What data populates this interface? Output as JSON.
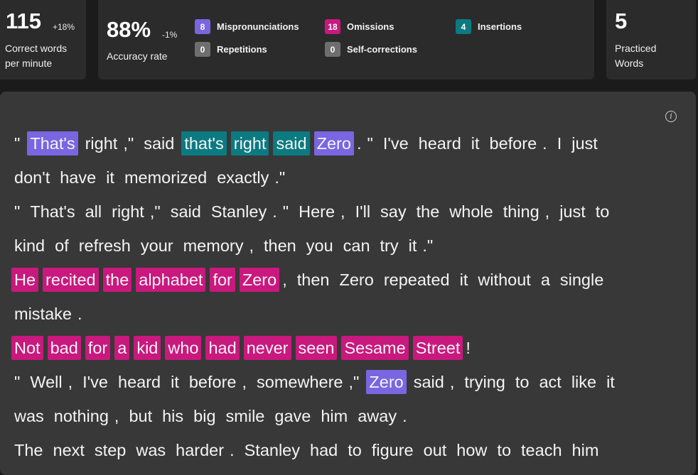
{
  "stats": {
    "wpm": {
      "value": "115",
      "delta": "+18%",
      "label_line1": "Correct words",
      "label_line2": "per minute"
    },
    "accuracy": {
      "value": "88%",
      "delta": "-1%",
      "label": "Accuracy rate"
    },
    "practiced": {
      "value": "5",
      "label_line1": "Practiced",
      "label_line2": "Words"
    }
  },
  "legend": [
    {
      "count": "8",
      "label": "Mispronunciations",
      "color": "#7966e0"
    },
    {
      "count": "18",
      "label": "Omissions",
      "color": "#c9187e"
    },
    {
      "count": "4",
      "label": "Insertions",
      "color": "#0c7a81"
    },
    {
      "count": "0",
      "label": "Repetitions",
      "color": "#6e6e6e"
    },
    {
      "count": "0",
      "label": "Self-corrections",
      "color": "#6e6e6e"
    }
  ],
  "passage": {
    "info_icon_glyph": "i",
    "lines": [
      [
        [
          "\"",
          ""
        ],
        [
          "That's",
          "purple"
        ],
        [
          "right",
          ""
        ],
        [
          ",\"",
          ""
        ],
        [
          "said",
          ""
        ],
        [
          "that's",
          "teal"
        ],
        [
          "right",
          "teal"
        ],
        [
          "said",
          "teal"
        ],
        [
          "Zero",
          "purple"
        ],
        [
          ".",
          ""
        ],
        [
          "\"",
          ""
        ],
        [
          "I've",
          ""
        ],
        [
          "heard",
          ""
        ],
        [
          "it",
          ""
        ],
        [
          "before",
          ""
        ],
        [
          ".",
          ""
        ],
        [
          "I",
          ""
        ],
        [
          "just",
          ""
        ]
      ],
      [
        [
          "don't",
          ""
        ],
        [
          "have",
          ""
        ],
        [
          "it",
          ""
        ],
        [
          "memorized",
          ""
        ],
        [
          "exactly",
          ""
        ],
        [
          ".\"",
          ""
        ]
      ],
      [
        [
          "\"",
          ""
        ],
        [
          "That's",
          ""
        ],
        [
          "all",
          ""
        ],
        [
          "right",
          ""
        ],
        [
          ",\"",
          ""
        ],
        [
          "said",
          ""
        ],
        [
          "Stanley",
          ""
        ],
        [
          ".",
          ""
        ],
        [
          "\"",
          ""
        ],
        [
          "Here",
          ""
        ],
        [
          ",",
          ""
        ],
        [
          "I'll",
          ""
        ],
        [
          "say",
          ""
        ],
        [
          "the",
          ""
        ],
        [
          "whole",
          ""
        ],
        [
          "thing",
          ""
        ],
        [
          ",",
          ""
        ],
        [
          "just",
          ""
        ],
        [
          "to",
          ""
        ]
      ],
      [
        [
          "kind",
          ""
        ],
        [
          "of",
          ""
        ],
        [
          "refresh",
          ""
        ],
        [
          "your",
          ""
        ],
        [
          "memory",
          ""
        ],
        [
          ",",
          ""
        ],
        [
          "then",
          ""
        ],
        [
          "you",
          ""
        ],
        [
          "can",
          ""
        ],
        [
          "try",
          ""
        ],
        [
          "it",
          ""
        ],
        [
          ".\"",
          ""
        ]
      ],
      [
        [
          "He",
          "pink"
        ],
        [
          "recited",
          "pink"
        ],
        [
          "the",
          "pink"
        ],
        [
          "alphabet",
          "pink"
        ],
        [
          "for",
          "pink"
        ],
        [
          "Zero",
          "pink"
        ],
        [
          ",",
          ""
        ],
        [
          "then",
          ""
        ],
        [
          "Zero",
          ""
        ],
        [
          "repeated",
          ""
        ],
        [
          "it",
          ""
        ],
        [
          "without",
          ""
        ],
        [
          "a",
          ""
        ],
        [
          "single",
          ""
        ]
      ],
      [
        [
          "mistake",
          ""
        ],
        [
          ".",
          ""
        ]
      ],
      [
        [
          "Not",
          "pink"
        ],
        [
          "bad",
          "pink"
        ],
        [
          "for",
          "pink"
        ],
        [
          "a",
          "pink"
        ],
        [
          "kid",
          "pink"
        ],
        [
          "who",
          "pink"
        ],
        [
          "had",
          "pink"
        ],
        [
          "never",
          "pink"
        ],
        [
          "seen",
          "pink"
        ],
        [
          "Sesame",
          "pink"
        ],
        [
          "Street",
          "pink"
        ],
        [
          "!",
          ""
        ]
      ],
      [
        [
          "\"",
          ""
        ],
        [
          "Well",
          ""
        ],
        [
          ",",
          ""
        ],
        [
          "I've",
          ""
        ],
        [
          "heard",
          ""
        ],
        [
          "it",
          ""
        ],
        [
          "before",
          ""
        ],
        [
          ",",
          ""
        ],
        [
          "somewhere",
          ""
        ],
        [
          ",\"",
          ""
        ],
        [
          "Zero",
          "purple"
        ],
        [
          "said",
          ""
        ],
        [
          ",",
          ""
        ],
        [
          "trying",
          ""
        ],
        [
          "to",
          ""
        ],
        [
          "act",
          ""
        ],
        [
          "like",
          ""
        ],
        [
          "it",
          ""
        ]
      ],
      [
        [
          "was",
          ""
        ],
        [
          "nothing",
          ""
        ],
        [
          ",",
          ""
        ],
        [
          "but",
          ""
        ],
        [
          "his",
          ""
        ],
        [
          "big",
          ""
        ],
        [
          "smile",
          ""
        ],
        [
          "gave",
          ""
        ],
        [
          "him",
          ""
        ],
        [
          "away",
          ""
        ],
        [
          ".",
          ""
        ]
      ],
      [
        [
          "The",
          ""
        ],
        [
          "next",
          ""
        ],
        [
          "step",
          ""
        ],
        [
          "was",
          ""
        ],
        [
          "harder",
          ""
        ],
        [
          ".",
          ""
        ],
        [
          "Stanley",
          ""
        ],
        [
          "had",
          ""
        ],
        [
          "to",
          ""
        ],
        [
          "figure",
          ""
        ],
        [
          "out",
          ""
        ],
        [
          "how",
          ""
        ],
        [
          "to",
          ""
        ],
        [
          "teach",
          ""
        ],
        [
          "him",
          ""
        ]
      ]
    ]
  }
}
